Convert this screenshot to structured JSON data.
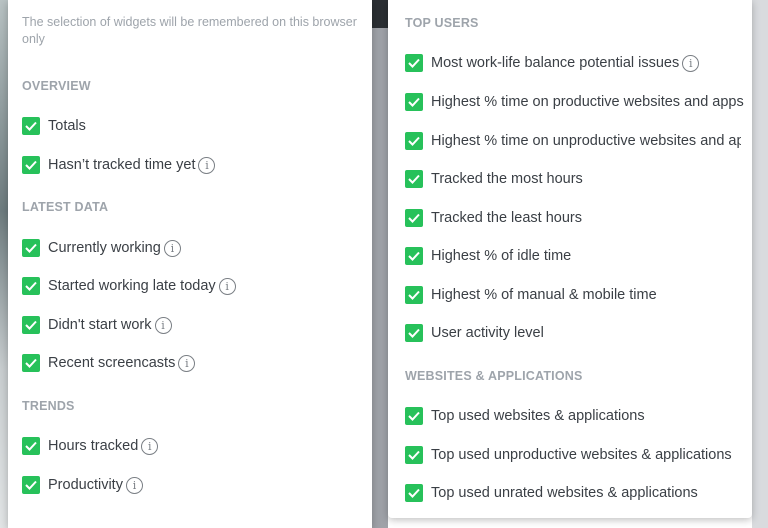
{
  "left_panel": {
    "note": "The selection of widgets will be remembered on this browser only",
    "sections": {
      "overview": "OVERVIEW",
      "latest_data": "LATEST DATA",
      "trends": "TRENDS"
    },
    "items": {
      "totals": "Totals",
      "hasnt_tracked": "Hasn’t tracked time yet",
      "currently_working": "Currently working",
      "started_late": "Started working late today",
      "didnt_start": "Didn't start work",
      "recent_screencasts": "Recent screencasts",
      "hours_tracked": "Hours tracked",
      "productivity": "Productivity"
    }
  },
  "right_panel": {
    "sections": {
      "top_users": "TOP USERS",
      "websites_apps": "WEBSITES & APPLICATIONS"
    },
    "items": {
      "work_life": "Most work-life balance potential issues",
      "productive": "Highest % time on productive websites and apps",
      "unproductive": "Highest % time on unproductive websites and apps",
      "most_hours": "Tracked the most hours",
      "least_hours": "Tracked the least hours",
      "idle_time": "Highest % of idle time",
      "manual_mobile": "Highest % of manual & mobile time",
      "activity_level": "User activity level",
      "top_used": "Top used websites & applications",
      "top_unproductive": "Top used unproductive websites & applications",
      "top_unrated": "Top used unrated websites & applications"
    }
  },
  "colors": {
    "check": "#27c15a",
    "section": "#9ea4ab",
    "label": "#3a3f45"
  },
  "icons": {
    "checkbox": "check-icon",
    "info": "info-icon",
    "info_glyph": "i"
  }
}
